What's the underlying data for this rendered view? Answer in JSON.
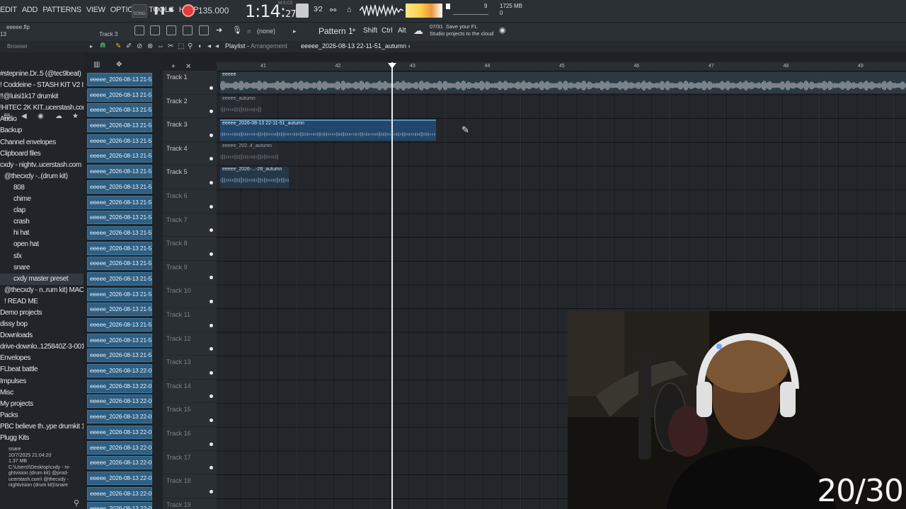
{
  "menu": [
    "EDIT",
    "ADD",
    "PATTERNS",
    "VIEW",
    "OPTIONS",
    "TOOLS",
    "HELP"
  ],
  "transport": {
    "song_label": "SONG",
    "tempo": "135.000",
    "time": "1:14",
    "time_sub": "27",
    "mscs": "M:S:CS",
    "cpu": "9",
    "ram": "1725 MB",
    "ram_sub": "0"
  },
  "bar2": {
    "project_file": "eeeee.flp",
    "track_hint": "Track 3",
    "track_num": "13",
    "snap": "(none)",
    "pattern": "Pattern 1",
    "shift": "Shift",
    "ctrl": "Ctrl",
    "alt": "Alt",
    "cloud_count": "07/31",
    "cloud_msg1": "Save your FL",
    "cloud_msg2": "Studio projects to the cloud"
  },
  "playlist": {
    "title": "Playlist",
    "subtitle": "Arrangement",
    "file": "eeeee_2026-08-13 22-11-51_autumn",
    "ruler": [
      "41",
      "42",
      "43",
      "44",
      "45",
      "46",
      "47",
      "48",
      "49"
    ]
  },
  "browser": {
    "title": "Browser",
    "items": [
      {
        "t": "#stepnine.Dr..5 (@tec9beat)",
        "sub": false
      },
      {
        "t": "! Coddeine - STASH KIT V2 I",
        "sub": false
      },
      {
        "t": "!!@luisi1k17 drumkit",
        "sub": false
      },
      {
        "t": "!HITEC 2K KIT..ucerstash.com",
        "sub": false
      },
      {
        "t": "Audio",
        "sub": false
      },
      {
        "t": "Backup",
        "sub": false
      },
      {
        "t": "Channel envelopes",
        "sub": false
      },
      {
        "t": "Clipboard files",
        "sub": false
      },
      {
        "t": "cxdy - nightv..ucerstash.com",
        "sub": false
      },
      {
        "t": "@thecxdy -..(drum kit)",
        "sub": false,
        "ind": true
      },
      {
        "t": "808",
        "sub": true
      },
      {
        "t": "chime",
        "sub": true
      },
      {
        "t": "clap",
        "sub": true
      },
      {
        "t": "crash",
        "sub": true
      },
      {
        "t": "hi hat",
        "sub": true
      },
      {
        "t": "open hat",
        "sub": true
      },
      {
        "t": "sfx",
        "sub": true
      },
      {
        "t": "snare",
        "sub": true
      },
      {
        "t": "cxdy master preset",
        "sub": true,
        "hl": true
      },
      {
        "t": "@thecxdy - n..rum kit) MAC",
        "sub": false,
        "ind": true
      },
      {
        "t": "! READ ME",
        "sub": false,
        "ind": true
      },
      {
        "t": "Demo projects",
        "sub": false
      },
      {
        "t": "dissy bop",
        "sub": false
      },
      {
        "t": "Downloads",
        "sub": false
      },
      {
        "t": "drive-downlo..125840Z-3-001",
        "sub": false
      },
      {
        "t": "Envelopes",
        "sub": false
      },
      {
        "t": "FLbeat battle",
        "sub": false
      },
      {
        "t": "Impulses",
        "sub": false
      },
      {
        "t": "Misc",
        "sub": false
      },
      {
        "t": "My projects",
        "sub": false
      },
      {
        "t": "Packs",
        "sub": false
      },
      {
        "t": "PBC believe th..ype drumkit 1",
        "sub": false
      },
      {
        "t": "Plugg Kits",
        "sub": false
      }
    ],
    "info": [
      "snare",
      "10/7/2025 21:04:20",
      "1.37 MB",
      "C:\\Users\\\\Desktop\\cxdy - ni-",
      "ghtvision (drum kit) @prod-",
      "ucerstash.com\\ @thecxdy -",
      "nightvision (drum kit)\\snare"
    ]
  },
  "clips": [
    "eeeee_2026-08-13 21-5..",
    "eeeee_2026-08-13 21-5..",
    "eeeee_2026-08-13 21-5..",
    "eeeee_2026-08-13 21-5..",
    "eeeee_2026-08-13 21-5..",
    "eeeee_2026-08-13 21-5..",
    "eeeee_2026-08-13 21-5..",
    "eeeee_2026-08-13 21-5..",
    "eeeee_2026-08-13 21-5..",
    "eeeee_2026-08-13 21-5..",
    "eeeee_2026-08-13 21-5..",
    "eeeee_2026-08-13 21-5..",
    "eeeee_2026-08-13 21-5..",
    "eeeee_2026-08-13 21-5..",
    "eeeee_2026-08-13 21-5..",
    "eeeee_2026-08-13 21-5..",
    "eeeee_2026-08-13 21-5..",
    "eeeee_2026-08-13 21-5..",
    "eeeee_2026-08-13 21-5..",
    "eeeee_2026-08-13 22-0..",
    "eeeee_2026-08-13 22-0..",
    "eeeee_2026-08-13 22-0..",
    "eeeee_2026-08-13 22-0..",
    "eeeee_2026-08-13 22-0..",
    "eeeee_2026-08-13 22-0..",
    "eeeee_2026-08-13 22-0..",
    "eeeee_2026-08-13 22-0..",
    "eeeee_2026-08-13 22-0..",
    "eeeee_2026-08-13 22-0.."
  ],
  "tracks": [
    "Track 1",
    "Track 2",
    "Track 3",
    "Track 4",
    "Track 5",
    "Track 6",
    "Track 7",
    "Track 8",
    "Track 9",
    "Track 10",
    "Track 11",
    "Track 12",
    "Track 13",
    "Track 14",
    "Track 15",
    "Track 16",
    "Track 17",
    "Track 18",
    "Track 19"
  ],
  "playlist_clips": [
    {
      "label": "eeeee",
      "track": 0
    },
    {
      "label": "eeeee_autumn",
      "track": 1
    },
    {
      "label": "eeeee_2026-08-13 22-11-51_autumn",
      "track": 2
    },
    {
      "label": "eeeee_202..4_autumn",
      "track": 3
    },
    {
      "label": "eeeee_2026-...-28_autumn",
      "track": 4
    }
  ],
  "overlay": {
    "counter": "20/30"
  }
}
